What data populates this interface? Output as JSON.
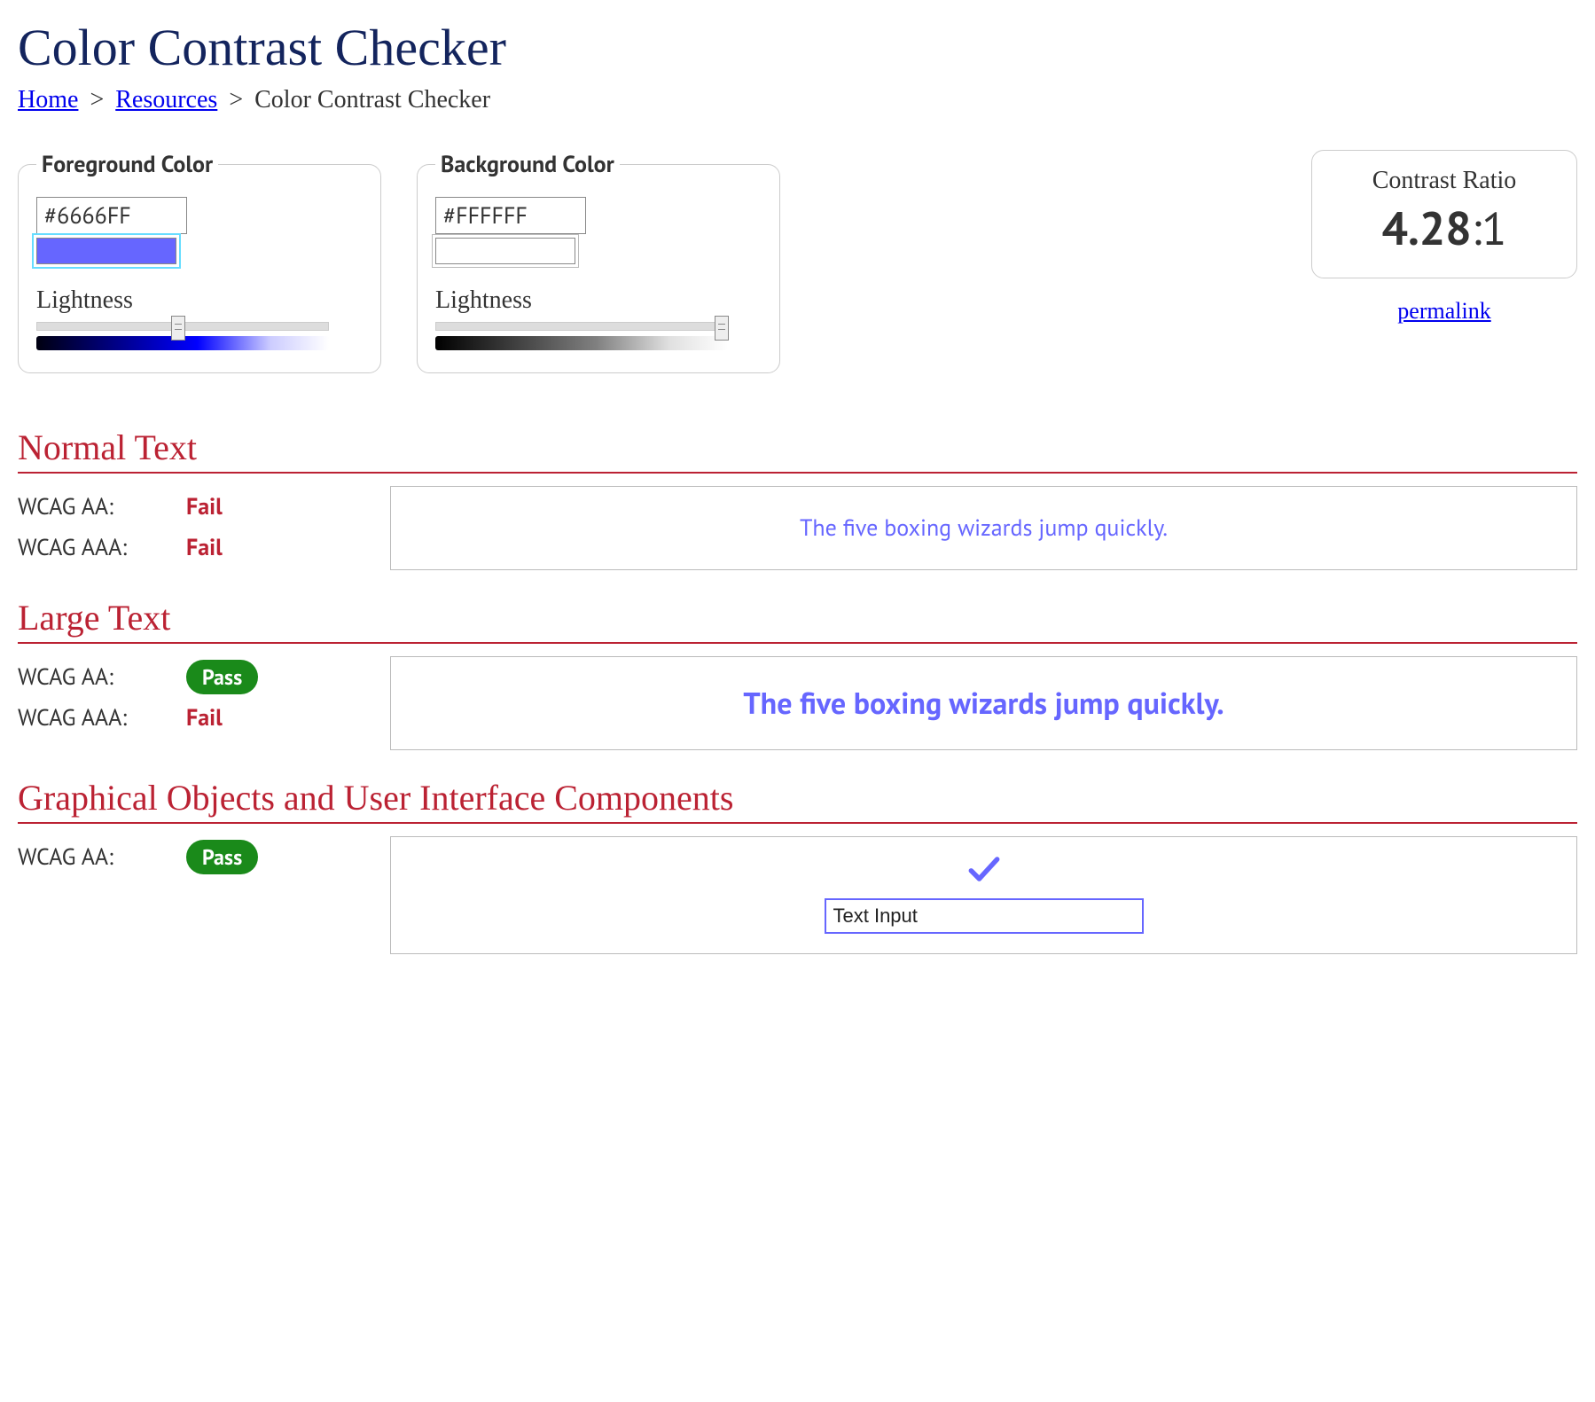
{
  "pageTitle": "Color Contrast Checker",
  "breadcrumb": {
    "home": "Home",
    "resources": "Resources",
    "current": "Color Contrast Checker",
    "sep": ">"
  },
  "foreground": {
    "legend": "Foreground Color",
    "hex": "#6666FF",
    "swatchColor": "#6666FF",
    "lightnessLabel": "Lightness",
    "lightnessPercent": 48
  },
  "background": {
    "legend": "Background Color",
    "hex": "#FFFFFF",
    "swatchColor": "#FFFFFF",
    "lightnessLabel": "Lightness",
    "lightnessPercent": 100
  },
  "ratio": {
    "title": "Contrast Ratio",
    "value": "4.28",
    "suffix": ":1",
    "permalink": "permalink"
  },
  "normalText": {
    "heading": "Normal Text",
    "wcagAALabel": "WCAG AA:",
    "wcagAAResult": "Fail",
    "wcagAAALabel": "WCAG AAA:",
    "wcagAAAResult": "Fail",
    "sample": "The five boxing wizards jump quickly."
  },
  "largeText": {
    "heading": "Large Text",
    "wcagAALabel": "WCAG AA:",
    "wcagAAResult": "Pass",
    "wcagAAALabel": "WCAG AAA:",
    "wcagAAAResult": "Fail",
    "sample": "The five boxing wizards jump quickly."
  },
  "uiComponents": {
    "heading": "Graphical Objects and User Interface Components",
    "wcagAALabel": "WCAG AA:",
    "wcagAAResult": "Pass",
    "inputValue": "Text Input"
  },
  "colors": {
    "fg": "#6666FF",
    "bg": "#FFFFFF",
    "fail": "#bb2233",
    "pass": "#1a8a1a"
  }
}
